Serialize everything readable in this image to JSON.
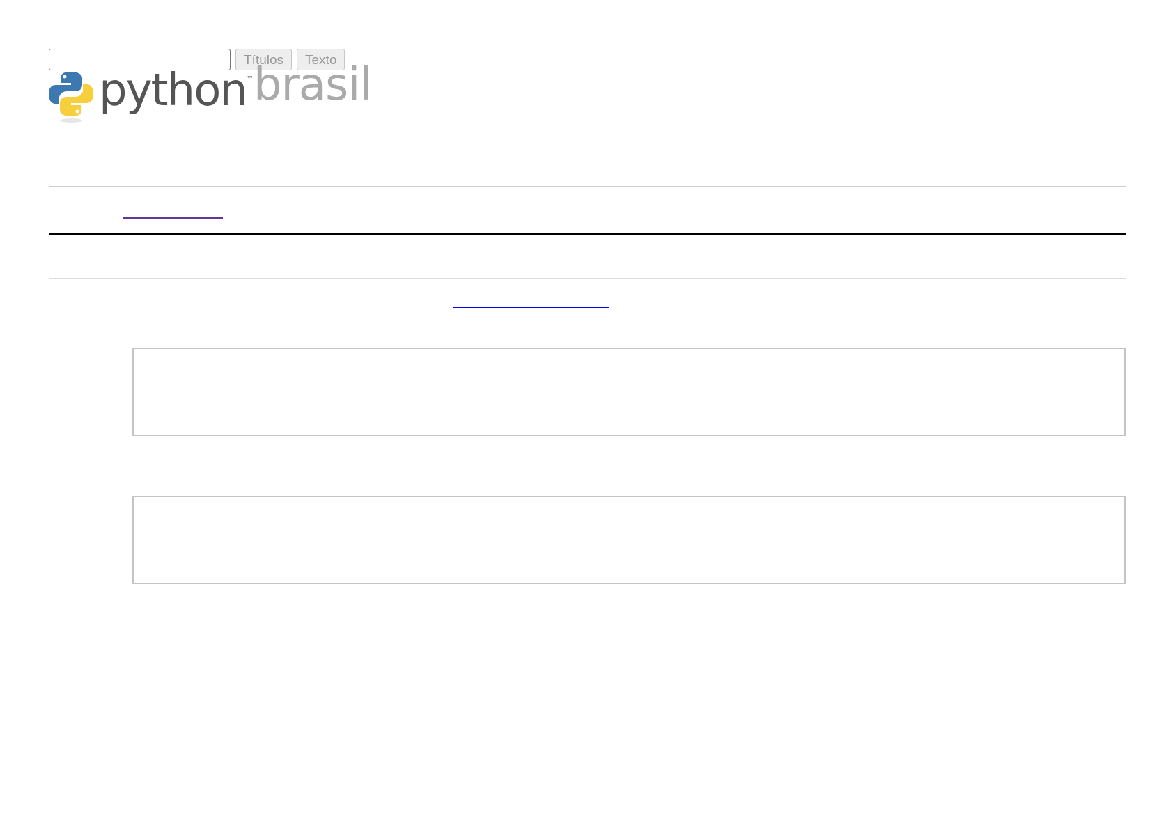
{
  "search": {
    "buttons": [
      "Títulos",
      "Texto"
    ]
  },
  "logo": {
    "word": "python",
    "trademark": "™",
    "suffix": "brasil"
  },
  "links": [
    {
      "visited": true
    },
    {
      "visited": false
    }
  ]
}
